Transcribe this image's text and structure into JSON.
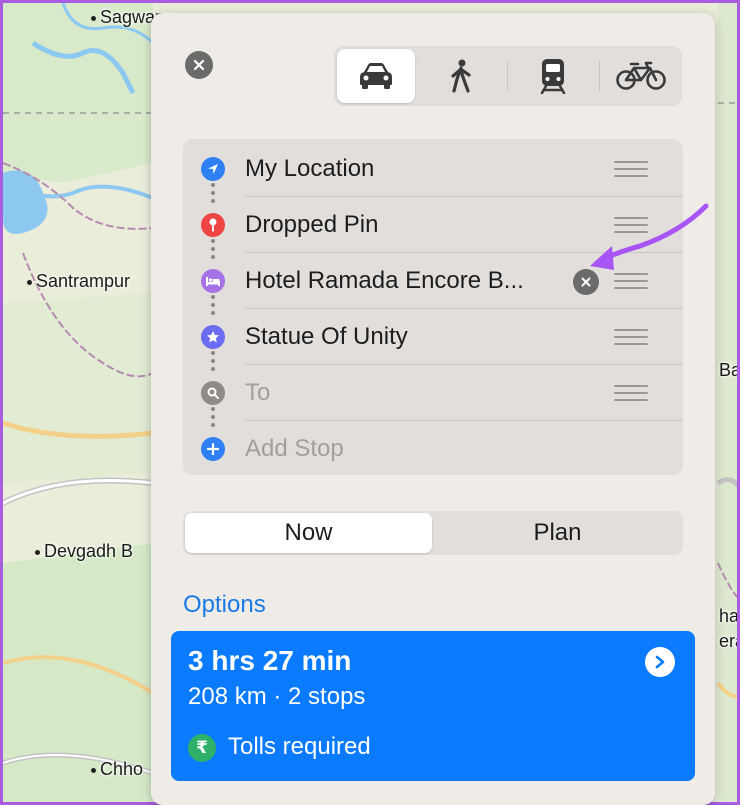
{
  "map": {
    "places": [
      "Sagwara",
      "Santrampur",
      "Devgadh B",
      "Chho",
      "Ba",
      "har",
      "era"
    ]
  },
  "panel": {
    "close_icon": "close-icon",
    "transport_modes": [
      {
        "name": "driving",
        "icon": "car-icon",
        "selected": true
      },
      {
        "name": "walking",
        "icon": "walking-person-icon",
        "selected": false
      },
      {
        "name": "transit",
        "icon": "train-icon",
        "selected": false
      },
      {
        "name": "cycling",
        "icon": "bicycle-icon",
        "selected": false
      }
    ],
    "stops": [
      {
        "label": "My Location",
        "icon": "location-arrow-icon",
        "color": "#2f7ff5"
      },
      {
        "label": "Dropped Pin",
        "icon": "pin-icon",
        "color": "#ef4444"
      },
      {
        "label": "Hotel Ramada Encore B...",
        "icon": "bed-icon",
        "color": "#a673e6",
        "clearable": true
      },
      {
        "label": "Statue Of Unity",
        "icon": "star-icon",
        "color": "#6b6cf2"
      },
      {
        "label": "To",
        "icon": "search-icon",
        "color": "#8e8b88",
        "placeholder": true
      },
      {
        "label": "Add Stop",
        "icon": "plus-icon",
        "color": "#2f7ff5",
        "placeholder": true
      }
    ],
    "time_segment": {
      "now": "Now",
      "plan": "Plan",
      "selected": "now"
    },
    "options_label": "Options",
    "route": {
      "duration": "3 hrs 27 min",
      "summary": "208 km · 2 stops",
      "tolls_symbol": "₹",
      "tolls_text": "Tolls required",
      "color": "#0a7aff"
    }
  },
  "annotation": {
    "arrow_color": "#a855f7"
  }
}
